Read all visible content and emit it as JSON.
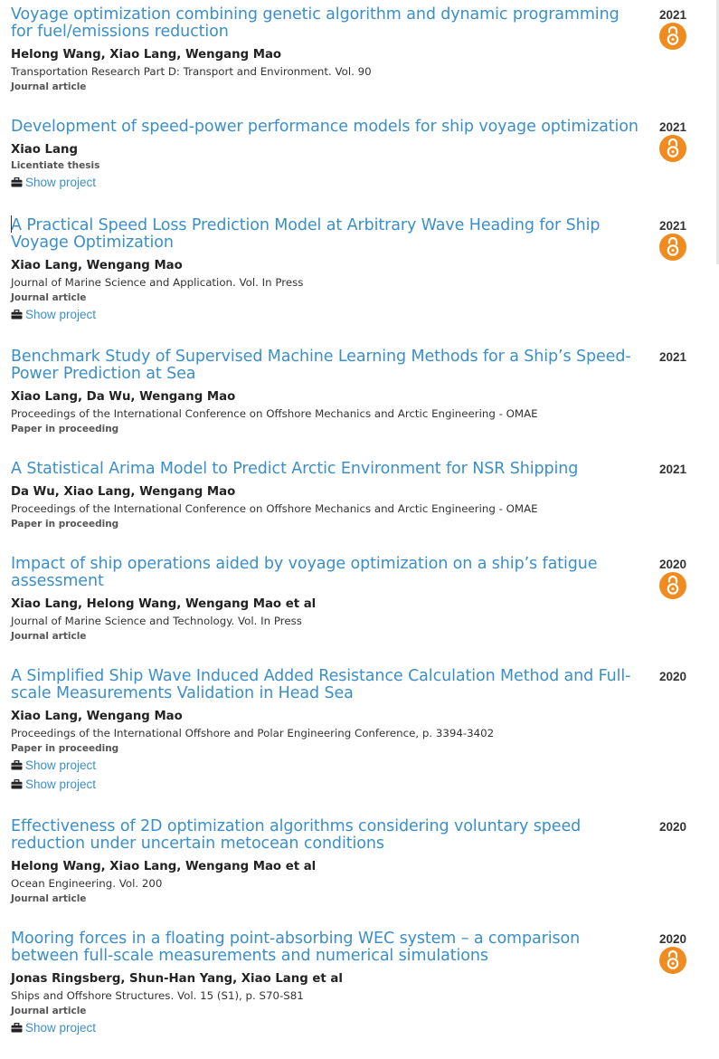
{
  "colors": {
    "link": "#3b8fc9",
    "open_access": "#f08c1f",
    "text": "#222222"
  },
  "icons": {
    "open_access": "open-access-icon",
    "project": "briefcase-icon"
  },
  "publications": [
    {
      "title": "Voyage optimization combining genetic algorithm and dynamic programming for fuel/emissions reduction",
      "year": "2021",
      "authors": "Helong Wang, Xiao Lang, Wengang Mao",
      "source": "Transportation Research Part D: Transport and Environment. Vol. 90",
      "type": "Journal article",
      "open_access": true,
      "projects": []
    },
    {
      "title": "Development of speed-power performance models for ship voyage optimization",
      "year": "2021",
      "authors": "Xiao Lang",
      "source": "",
      "type": "Licentiate thesis",
      "open_access": true,
      "projects": [
        "Show project"
      ]
    },
    {
      "title": "A Practical Speed Loss Prediction Model at Arbitrary Wave Heading for Ship Voyage Optimization",
      "year": "2021",
      "authors": "Xiao Lang, Wengang Mao",
      "source": "Journal of Marine Science and Application. Vol. In Press",
      "type": "Journal article",
      "open_access": true,
      "projects": [
        "Show project"
      ]
    },
    {
      "title": "Benchmark Study of Supervised Machine Learning Methods for a Ship’s Speed-Power Prediction at Sea",
      "year": "2021",
      "authors": "Xiao Lang, Da Wu, Wengang Mao",
      "source": "Proceedings of the International Conference on Offshore Mechanics and Arctic Engineering - OMAE",
      "type": "Paper in proceeding",
      "open_access": false,
      "projects": []
    },
    {
      "title": "A Statistical Arima Model to Predict Arctic Environment for NSR Shipping",
      "year": "2021",
      "authors": "Da Wu, Xiao Lang, Wengang Mao",
      "source": "Proceedings of the International Conference on Offshore Mechanics and Arctic Engineering - OMAE",
      "type": "Paper in proceeding",
      "open_access": false,
      "projects": []
    },
    {
      "title": "Impact of ship operations aided by voyage optimization on a ship’s fatigue assessment",
      "year": "2020",
      "authors": "Xiao Lang, Helong Wang, Wengang Mao et al",
      "source": "Journal of Marine Science and Technology. Vol. In Press",
      "type": "Journal article",
      "open_access": true,
      "projects": []
    },
    {
      "title": "A Simplified Ship Wave Induced Added Resistance Calculation Method and Full-scale Measurements Validation in Head Sea",
      "year": "2020",
      "authors": "Xiao Lang, Wengang Mao",
      "source": "Proceedings of the International Offshore and Polar Engineering Conference, p. 3394-3402",
      "type": "Paper in proceeding",
      "open_access": false,
      "projects": [
        "Show project",
        "Show project"
      ]
    },
    {
      "title": "Effectiveness of 2D optimization algorithms considering voluntary speed reduction under uncertain metocean conditions",
      "year": "2020",
      "authors": "Helong Wang, Xiao Lang, Wengang Mao et al",
      "source": "Ocean Engineering. Vol. 200",
      "type": "Journal article",
      "open_access": false,
      "projects": []
    },
    {
      "title": "Mooring forces in a floating point-absorbing WEC system – a comparison between full-scale measurements and numerical simulations",
      "year": "2020",
      "authors": "Jonas Ringsberg, Shun-Han Yang, Xiao Lang et al",
      "source": "Ships and Offshore Structures. Vol. 15 (S1), p. S70-S81",
      "type": "Journal article",
      "open_access": true,
      "projects": [
        "Show project"
      ]
    }
  ]
}
